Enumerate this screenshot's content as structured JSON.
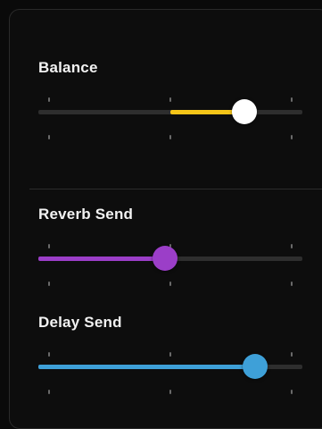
{
  "sliders": [
    {
      "label": "Balance",
      "mode": "center",
      "value": 0.78,
      "color": "#f5c518",
      "thumb_color": "#ffffff",
      "track_color": "#2e2e2e",
      "ticks": [
        0.04,
        0.5,
        0.96
      ]
    },
    {
      "label": "Reverb Send",
      "mode": "start",
      "value": 0.48,
      "color": "#9b3ec8",
      "thumb_color": "#9b3ec8",
      "track_color": "#2e2e2e",
      "ticks": [
        0.04,
        0.5,
        0.96
      ]
    },
    {
      "label": "Delay Send",
      "mode": "start",
      "value": 0.82,
      "color": "#3ea0d8",
      "thumb_color": "#3ea0d8",
      "track_color": "#2e2e2e",
      "ticks": [
        0.04,
        0.5,
        0.96
      ]
    }
  ]
}
